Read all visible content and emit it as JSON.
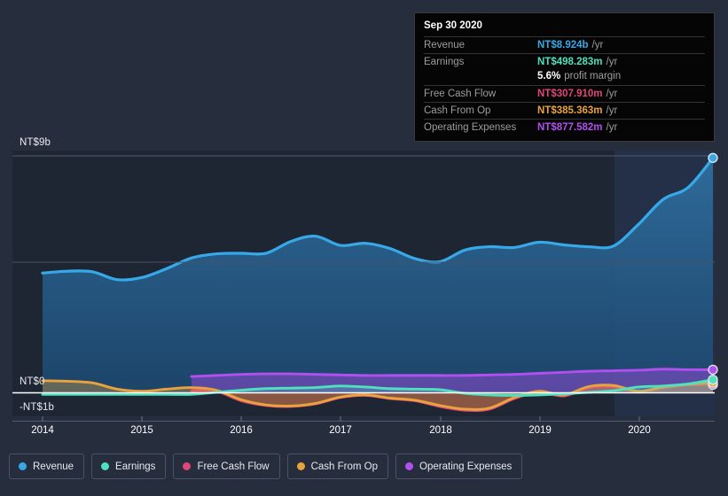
{
  "tooltip": {
    "date": "Sep 30 2020",
    "rows": [
      {
        "label": "Revenue",
        "value": "NT$8.924b",
        "unit": "/yr",
        "color": "#37a9e8"
      },
      {
        "label": "Earnings",
        "value": "NT$498.283m",
        "unit": "/yr",
        "color": "#4fe0bd"
      },
      {
        "label": "Free Cash Flow",
        "value": "NT$307.910m",
        "unit": "/yr",
        "color": "#e0457b"
      },
      {
        "label": "Cash From Op",
        "value": "NT$385.363m",
        "unit": "/yr",
        "color": "#e8a33d"
      },
      {
        "label": "Operating Expenses",
        "value": "NT$877.582m",
        "unit": "/yr",
        "color": "#b14ff0"
      }
    ],
    "margin_value": "5.6%",
    "margin_label": "profit margin"
  },
  "legend": [
    {
      "label": "Revenue",
      "color": "#37a9e8"
    },
    {
      "label": "Earnings",
      "color": "#4fe0bd"
    },
    {
      "label": "Free Cash Flow",
      "color": "#e0457b"
    },
    {
      "label": "Cash From Op",
      "color": "#e8a33d"
    },
    {
      "label": "Operating Expenses",
      "color": "#b14ff0"
    }
  ],
  "axis": {
    "y_top": "NT$9b",
    "y_zero": "NT$0",
    "y_bottom": "-NT$1b",
    "x_ticks": [
      "2014",
      "2015",
      "2016",
      "2017",
      "2018",
      "2019",
      "2020"
    ]
  },
  "chart_data": {
    "type": "area",
    "title": "",
    "xlabel": "",
    "ylabel": "NT$",
    "ylim": [
      -1,
      9
    ],
    "xlim": [
      2014,
      2020.75
    ],
    "grid": true,
    "gridlines": [
      9,
      5,
      0
    ],
    "legend_position": "bottom",
    "highlight_region": {
      "from": 2019.76,
      "to": 2020.75,
      "note": "lighter shaded recent period"
    },
    "x": [
      2014.0,
      2014.25,
      2014.5,
      2014.75,
      2015.0,
      2015.25,
      2015.5,
      2015.75,
      2016.0,
      2016.25,
      2016.5,
      2016.75,
      2017.0,
      2017.25,
      2017.5,
      2017.75,
      2018.0,
      2018.25,
      2018.5,
      2018.75,
      2019.0,
      2019.25,
      2019.5,
      2019.75,
      2020.0,
      2020.25,
      2020.5,
      2020.75
    ],
    "series": [
      {
        "name": "Revenue",
        "color": "#37a9e8",
        "values": [
          4.55,
          4.62,
          4.6,
          4.3,
          4.38,
          4.72,
          5.12,
          5.28,
          5.3,
          5.3,
          5.75,
          5.95,
          5.6,
          5.68,
          5.48,
          5.1,
          4.98,
          5.42,
          5.55,
          5.52,
          5.72,
          5.62,
          5.55,
          5.58,
          6.4,
          7.35,
          7.8,
          8.924
        ]
      },
      {
        "name": "Earnings",
        "color": "#4fe0bd",
        "values": [
          -0.06,
          -0.06,
          -0.06,
          -0.06,
          -0.06,
          -0.06,
          -0.06,
          0.02,
          0.1,
          0.16,
          0.18,
          0.2,
          0.26,
          0.22,
          0.16,
          0.14,
          0.12,
          -0.02,
          -0.08,
          -0.1,
          -0.08,
          -0.04,
          0.02,
          0.08,
          0.22,
          0.26,
          0.34,
          0.498
        ]
      },
      {
        "name": "Free Cash Flow",
        "color": "#e0457b",
        "values": [
          null,
          null,
          null,
          null,
          null,
          null,
          0.08,
          0.06,
          -0.3,
          -0.48,
          -0.52,
          -0.42,
          -0.18,
          -0.1,
          -0.22,
          -0.3,
          -0.52,
          -0.66,
          -0.62,
          -0.22,
          0.02,
          -0.12,
          0.2,
          0.24,
          0.02,
          0.18,
          0.3,
          0.308
        ]
      },
      {
        "name": "Cash From Op",
        "color": "#e8a33d",
        "values": [
          0.46,
          0.44,
          0.38,
          0.14,
          0.06,
          0.14,
          0.2,
          0.1,
          -0.26,
          -0.46,
          -0.5,
          -0.4,
          -0.16,
          -0.08,
          -0.2,
          -0.28,
          -0.48,
          -0.62,
          -0.58,
          -0.18,
          0.06,
          -0.08,
          0.24,
          0.28,
          0.06,
          0.22,
          0.32,
          0.385
        ]
      },
      {
        "name": "Operating Expenses",
        "color": "#b14ff0",
        "values": [
          null,
          null,
          null,
          null,
          null,
          null,
          0.62,
          0.66,
          0.7,
          0.72,
          0.72,
          0.7,
          0.68,
          0.66,
          0.66,
          0.66,
          0.66,
          0.66,
          0.68,
          0.7,
          0.74,
          0.78,
          0.82,
          0.84,
          0.86,
          0.9,
          0.88,
          0.878
        ]
      }
    ]
  }
}
